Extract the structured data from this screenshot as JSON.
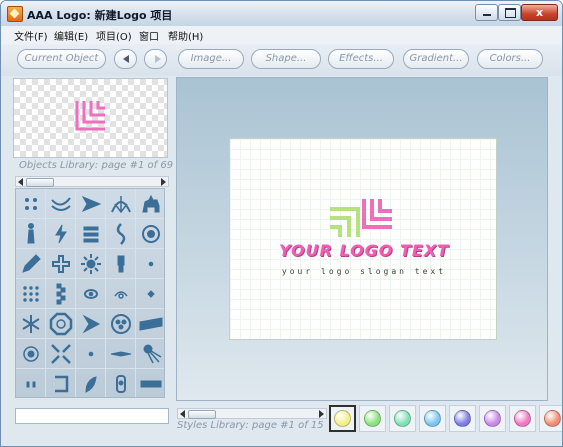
{
  "window": {
    "title": "AAA Logo: 新建Logo 项目",
    "close_glyph": "x"
  },
  "menu": [
    "文件(F)",
    "编辑(E)",
    "项目(O)",
    "窗口",
    "帮助(H)"
  ],
  "toolbar": {
    "current_object": "Current Object",
    "image": "Image...",
    "shape": "Shape...",
    "effects": "Effects...",
    "gradient": "Gradient...",
    "colors": "Colors..."
  },
  "objects_library": {
    "label": "Objects Library: page #1 of 69",
    "shapes": [
      "dots",
      "wave-lines",
      "arrow-right",
      "fan",
      "cat",
      "figure",
      "flash",
      "bars",
      "wave",
      "circle-ring",
      "pencil",
      "bracket-knot",
      "sun",
      "keyhole",
      "dot",
      "dot-grid",
      "checker",
      "eye",
      "knot",
      "diamond",
      "snowflake",
      "octagon",
      "arrowhead",
      "gear",
      "stripe-band",
      "flower",
      "burst-arrows",
      "dot",
      "bird",
      "squid",
      "tick-marks",
      "bracket",
      "leaf",
      "ring-tag",
      "bar"
    ]
  },
  "canvas": {
    "logo_text": "YOUR LOGO TEXT",
    "slogan": "your logo slogan text",
    "accent_pink": "#ef5fb4",
    "accent_green": "#b5e27f"
  },
  "styles_library": {
    "label": "Styles Library: page #1 of 15",
    "swatches": [
      {
        "name": "yellow",
        "color": "#f4ef86",
        "selected": true
      },
      {
        "name": "green",
        "color": "#8be27f",
        "selected": false
      },
      {
        "name": "mint",
        "color": "#7fe0b6",
        "selected": false
      },
      {
        "name": "sky",
        "color": "#79c7ef",
        "selected": false
      },
      {
        "name": "violet",
        "color": "#7d7ee0",
        "selected": false
      },
      {
        "name": "purple",
        "color": "#c989e8",
        "selected": false
      },
      {
        "name": "pink",
        "color": "#ef79c4",
        "selected": false
      },
      {
        "name": "salmon",
        "color": "#ef8d73",
        "selected": false
      }
    ]
  }
}
